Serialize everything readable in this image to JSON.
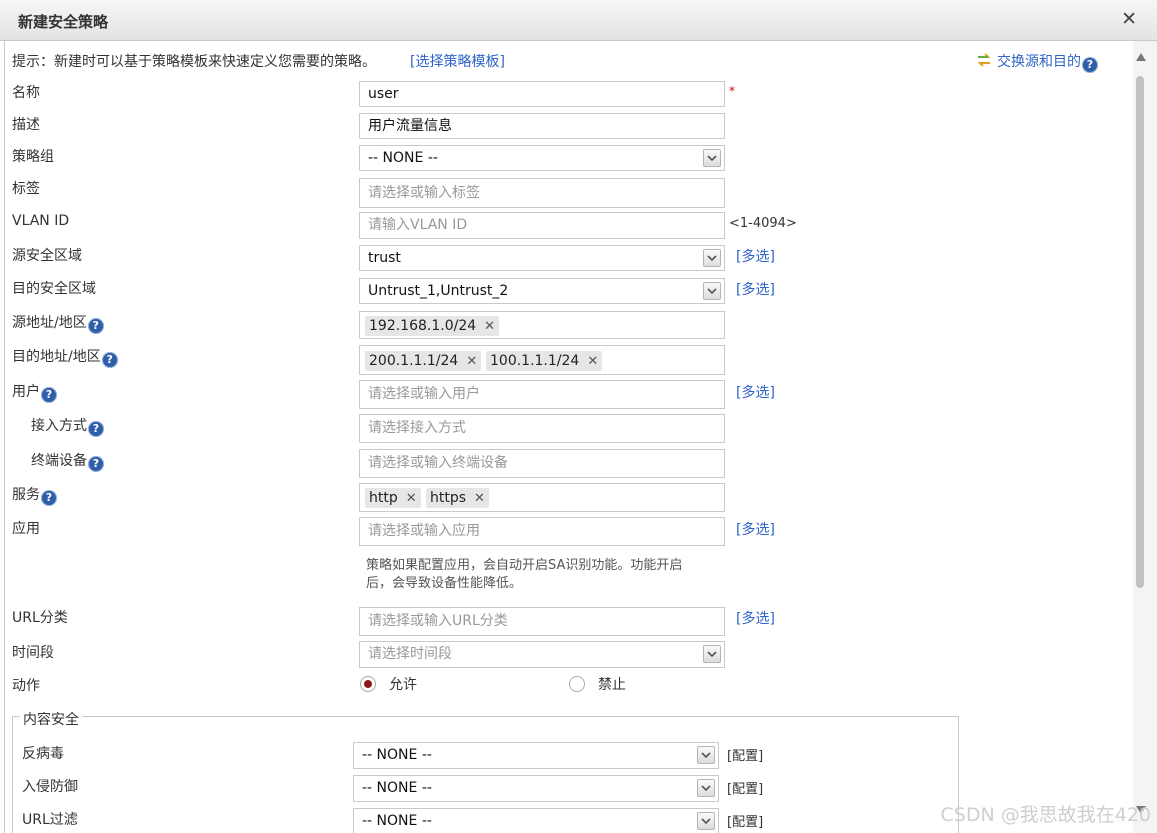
{
  "dialog": {
    "title": "新建安全策略",
    "close_glyph": "✕"
  },
  "hint": {
    "prefix": "提示：新建时可以基于策略模板来快速定义您需要的策略。",
    "template_link": "[选择策略模板]",
    "swap_link": "交换源和目的"
  },
  "form": {
    "name": {
      "label": "名称",
      "value": "user",
      "required_mark": "*"
    },
    "description": {
      "label": "描述",
      "value": "用户流量信息"
    },
    "policy_group": {
      "label": "策略组",
      "value": "-- NONE --"
    },
    "tag": {
      "label": "标签",
      "placeholder": "请选择或输入标签"
    },
    "vlan_id": {
      "label": "VLAN ID",
      "placeholder": "请输入VLAN ID",
      "range": "<1-4094>"
    },
    "src_zone": {
      "label": "源安全区域",
      "value": "trust",
      "multi": "[多选]"
    },
    "dst_zone": {
      "label": "目的安全区域",
      "value": "Untrust_1,Untrust_2",
      "multi": "[多选]"
    },
    "src_addr": {
      "label": "源地址/地区",
      "tags": [
        "192.168.1.0/24"
      ]
    },
    "dst_addr": {
      "label": "目的地址/地区",
      "tags": [
        "200.1.1.1/24",
        "100.1.1.1/24"
      ]
    },
    "user": {
      "label": "用户",
      "placeholder": "请选择或输入用户",
      "multi": "[多选]"
    },
    "access_mode": {
      "label": "接入方式",
      "placeholder": "请选择接入方式"
    },
    "terminal_device": {
      "label": "终端设备",
      "placeholder": "请选择或输入终端设备"
    },
    "service": {
      "label": "服务",
      "tags": [
        "http",
        "https"
      ]
    },
    "application": {
      "label": "应用",
      "placeholder": "请选择或输入应用",
      "multi": "[多选]",
      "note_line1": "策略如果配置应用，会自动开启SA识别功能。功能开启",
      "note_line2": "后，会导致设备性能降低。"
    },
    "url_category": {
      "label": "URL分类",
      "placeholder": "请选择或输入URL分类",
      "multi": "[多选]"
    },
    "time_range": {
      "label": "时间段",
      "placeholder": "请选择时间段"
    },
    "action": {
      "label": "动作",
      "permit": "允许",
      "deny": "禁止",
      "selected": "允许"
    }
  },
  "content_security": {
    "legend": "内容安全",
    "antivirus": {
      "label": "反病毒",
      "value": "-- NONE --",
      "config": "[配置]"
    },
    "ips": {
      "label": "入侵防御",
      "value": "-- NONE --",
      "config": "[配置]"
    },
    "url_filter": {
      "label": "URL过滤",
      "value": "-- NONE --",
      "config": "[配置]"
    }
  },
  "help_glyph": "?",
  "watermark": "CSDN @我思故我在420",
  "colors": {
    "link": "#2f64c8",
    "help_icon": "#2f5ea8",
    "required": "#dd0000",
    "radio_on": "#8a1a1a"
  }
}
